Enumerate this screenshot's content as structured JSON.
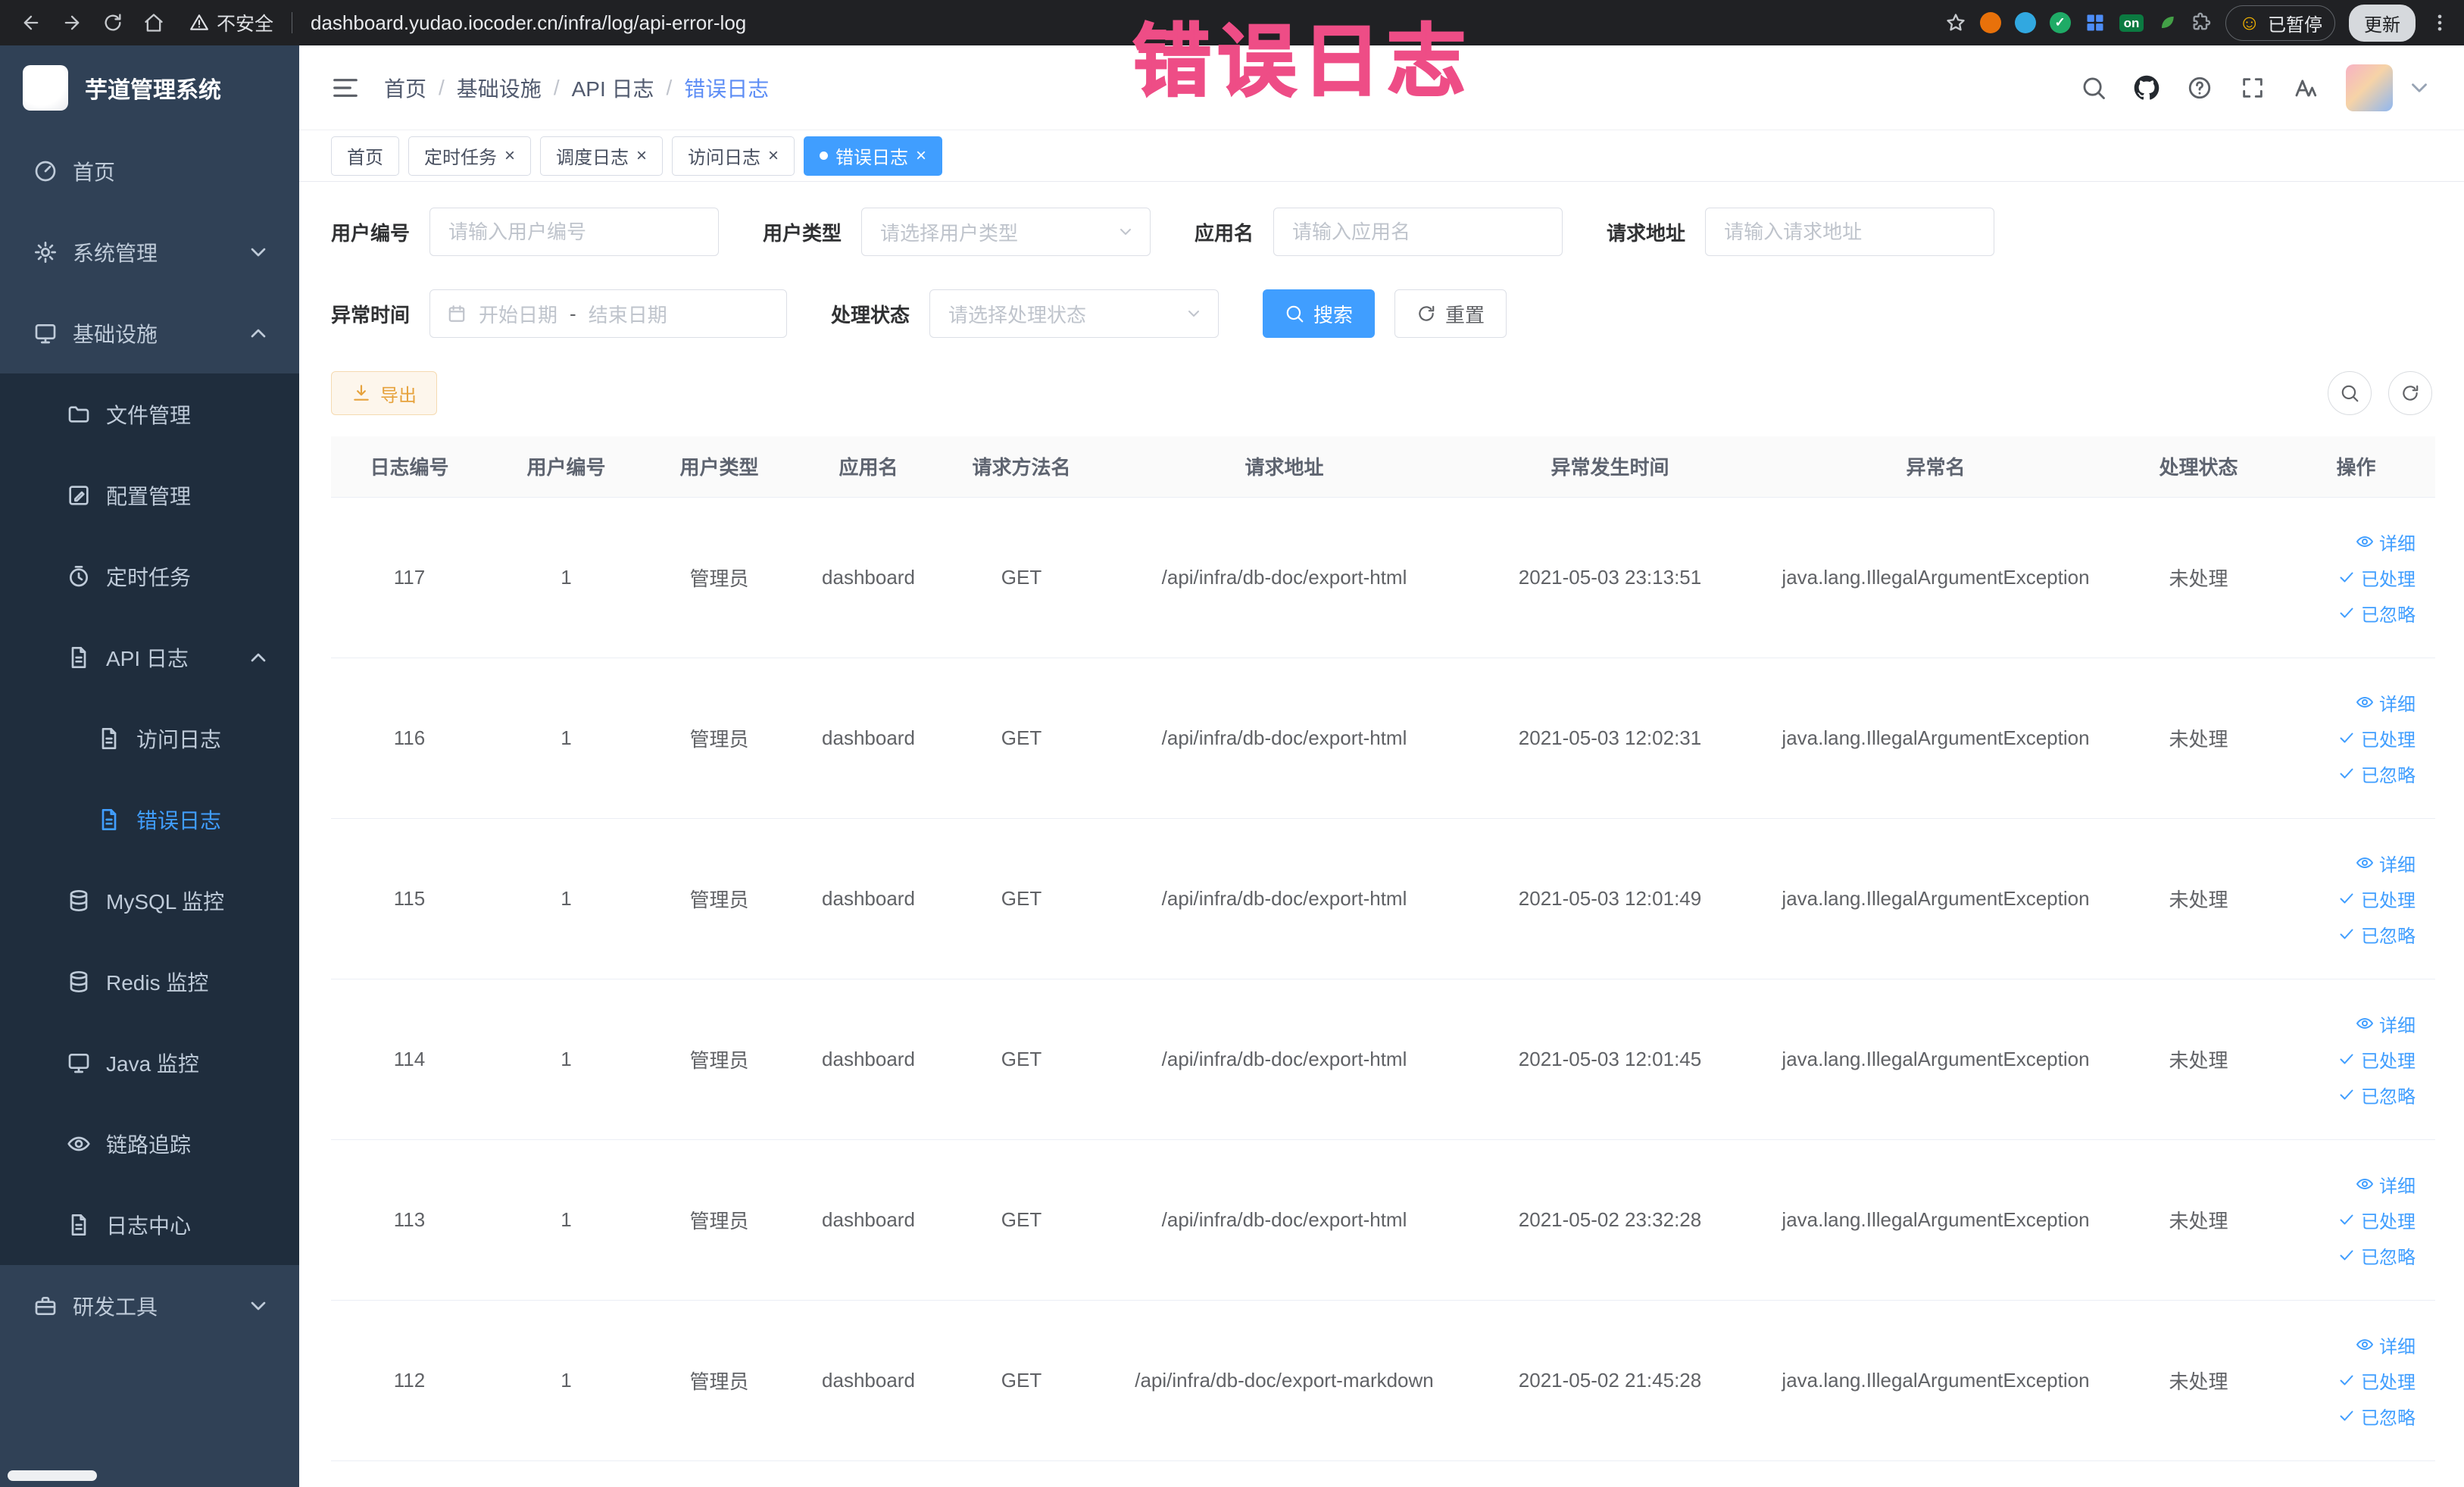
{
  "browser": {
    "security_label": "不安全",
    "url": "dashboard.yudao.iocoder.cn/infra/log/api-error-log",
    "extension_on_label": "on",
    "paused_badge": "已暂停",
    "update_button": "更新"
  },
  "annotation": {
    "text": "错误日志",
    "color": "#EE4D86"
  },
  "sidebar": {
    "logo_title": "芋道管理系统",
    "menu": [
      {
        "label": "首页",
        "icon": "dashboard-icon",
        "level": 1
      },
      {
        "label": "系统管理",
        "icon": "system-icon",
        "level": 1,
        "arrow": "down"
      },
      {
        "label": "基础设施",
        "icon": "infra-icon",
        "level": 1,
        "arrow": "up"
      },
      {
        "label": "文件管理",
        "icon": "file-manage-icon",
        "level": 2
      },
      {
        "label": "配置管理",
        "icon": "config-icon",
        "level": 2
      },
      {
        "label": "定时任务",
        "icon": "job-icon",
        "level": 2
      },
      {
        "label": "API 日志",
        "icon": "api-log-icon",
        "level": 2,
        "arrow": "up"
      },
      {
        "label": "访问日志",
        "icon": "access-log-icon",
        "level": 3
      },
      {
        "label": "错误日志",
        "icon": "error-log-icon",
        "level": 3,
        "active": true
      },
      {
        "label": "MySQL 监控",
        "icon": "mysql-icon",
        "level": 2
      },
      {
        "label": "Redis 监控",
        "icon": "redis-icon",
        "level": 2
      },
      {
        "label": "Java 监控",
        "icon": "java-icon",
        "level": 2
      },
      {
        "label": "链路追踪",
        "icon": "trace-icon",
        "level": 2
      },
      {
        "label": "日志中心",
        "icon": "log-center-icon",
        "level": 2
      },
      {
        "label": "研发工具",
        "icon": "devtools-icon",
        "level": 1,
        "arrow": "down"
      }
    ]
  },
  "header": {
    "breadcrumb": [
      "首页",
      "基础设施",
      "API 日志",
      "错误日志"
    ]
  },
  "tabs": [
    {
      "label": "首页",
      "closable": false,
      "active": false
    },
    {
      "label": "定时任务",
      "closable": true,
      "active": false
    },
    {
      "label": "调度日志",
      "closable": true,
      "active": false
    },
    {
      "label": "访问日志",
      "closable": true,
      "active": false
    },
    {
      "label": "错误日志",
      "closable": true,
      "active": true
    }
  ],
  "filters": {
    "user_id_label": "用户编号",
    "user_id_placeholder": "请输入用户编号",
    "user_type_label": "用户类型",
    "user_type_placeholder": "请选择用户类型",
    "app_name_label": "应用名",
    "app_name_placeholder": "请输入应用名",
    "request_url_label": "请求地址",
    "request_url_placeholder": "请输入请求地址",
    "exception_time_label": "异常时间",
    "date_start_placeholder": "开始日期",
    "date_separator": "-",
    "date_end_placeholder": "结束日期",
    "process_status_label": "处理状态",
    "process_status_placeholder": "请选择处理状态",
    "search_button": "搜索",
    "reset_button": "重置"
  },
  "toolbar": {
    "export_button": "导出"
  },
  "table": {
    "columns": [
      "日志编号",
      "用户编号",
      "用户类型",
      "应用名",
      "请求方法名",
      "请求地址",
      "异常发生时间",
      "异常名",
      "处理状态",
      "操作"
    ],
    "rows": [
      {
        "id": "117",
        "user_id": "1",
        "user_type": "管理员",
        "app": "dashboard",
        "method": "GET",
        "url": "/api/infra/db-doc/export-html",
        "time": "2021-05-03 23:13:51",
        "exception": "java.lang.IllegalArgumentException",
        "status": "未处理"
      },
      {
        "id": "116",
        "user_id": "1",
        "user_type": "管理员",
        "app": "dashboard",
        "method": "GET",
        "url": "/api/infra/db-doc/export-html",
        "time": "2021-05-03 12:02:31",
        "exception": "java.lang.IllegalArgumentException",
        "status": "未处理"
      },
      {
        "id": "115",
        "user_id": "1",
        "user_type": "管理员",
        "app": "dashboard",
        "method": "GET",
        "url": "/api/infra/db-doc/export-html",
        "time": "2021-05-03 12:01:49",
        "exception": "java.lang.IllegalArgumentException",
        "status": "未处理"
      },
      {
        "id": "114",
        "user_id": "1",
        "user_type": "管理员",
        "app": "dashboard",
        "method": "GET",
        "url": "/api/infra/db-doc/export-html",
        "time": "2021-05-03 12:01:45",
        "exception": "java.lang.IllegalArgumentException",
        "status": "未处理"
      },
      {
        "id": "113",
        "user_id": "1",
        "user_type": "管理员",
        "app": "dashboard",
        "method": "GET",
        "url": "/api/infra/db-doc/export-html",
        "time": "2021-05-02 23:32:28",
        "exception": "java.lang.IllegalArgumentException",
        "status": "未处理"
      },
      {
        "id": "112",
        "user_id": "1",
        "user_type": "管理员",
        "app": "dashboard",
        "method": "GET",
        "url": "/api/infra/db-doc/export-markdown",
        "time": "2021-05-02 21:45:28",
        "exception": "java.lang.IllegalArgumentException",
        "status": "未处理"
      }
    ],
    "actions": {
      "detail": "详细",
      "processed": "已处理",
      "ignored": "已忽略"
    }
  },
  "colors": {
    "accent": "#409EFF",
    "sidebar_bg": "#304156",
    "submenu_bg": "#1F2D3D",
    "warning": "#E6A23C",
    "annotation_pink": "#EE4D86"
  }
}
